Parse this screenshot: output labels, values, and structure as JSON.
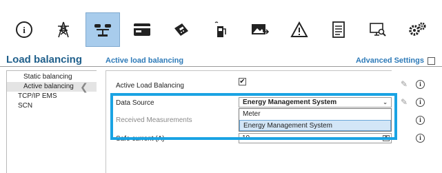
{
  "toolbar": {
    "items": [
      {
        "icon": "info-icon"
      },
      {
        "icon": "power-tower-icon"
      },
      {
        "icon": "load-balancing-icon",
        "active": true
      },
      {
        "icon": "card-icon"
      },
      {
        "icon": "payment-terminal-icon"
      },
      {
        "icon": "charging-station-icon"
      },
      {
        "icon": "image-transfer-icon"
      },
      {
        "icon": "warning-icon"
      },
      {
        "icon": "document-icon"
      },
      {
        "icon": "monitor-search-icon"
      },
      {
        "icon": "settings-icon"
      }
    ]
  },
  "section": {
    "title": "Load balancing",
    "subtitle": "Active load balancing",
    "advanced_label": "Advanced Settings"
  },
  "sidebar": {
    "items": [
      {
        "label": "Static balancing"
      },
      {
        "label": "Active balancing",
        "selected": true
      },
      {
        "label": "TCP/IP EMS"
      },
      {
        "label": "SCN"
      }
    ]
  },
  "form": {
    "active_label": "Active Load Balancing",
    "active_checked": true,
    "check_mark": "✔",
    "data_source_label": "Data Source",
    "data_source_value": "Energy Management System",
    "received_label": "Received Measurements",
    "safe_current_label": "Safe current (A)",
    "safe_current_value": "10",
    "dropdown_options": [
      {
        "label": "Meter"
      },
      {
        "label": "Energy Management System",
        "selected": true
      }
    ]
  },
  "colors": {
    "active_icon_bg": "#a8ccec",
    "highlight": "#1aa3e3",
    "title": "#1f5f8b",
    "subtitle": "#2d7ab8"
  }
}
